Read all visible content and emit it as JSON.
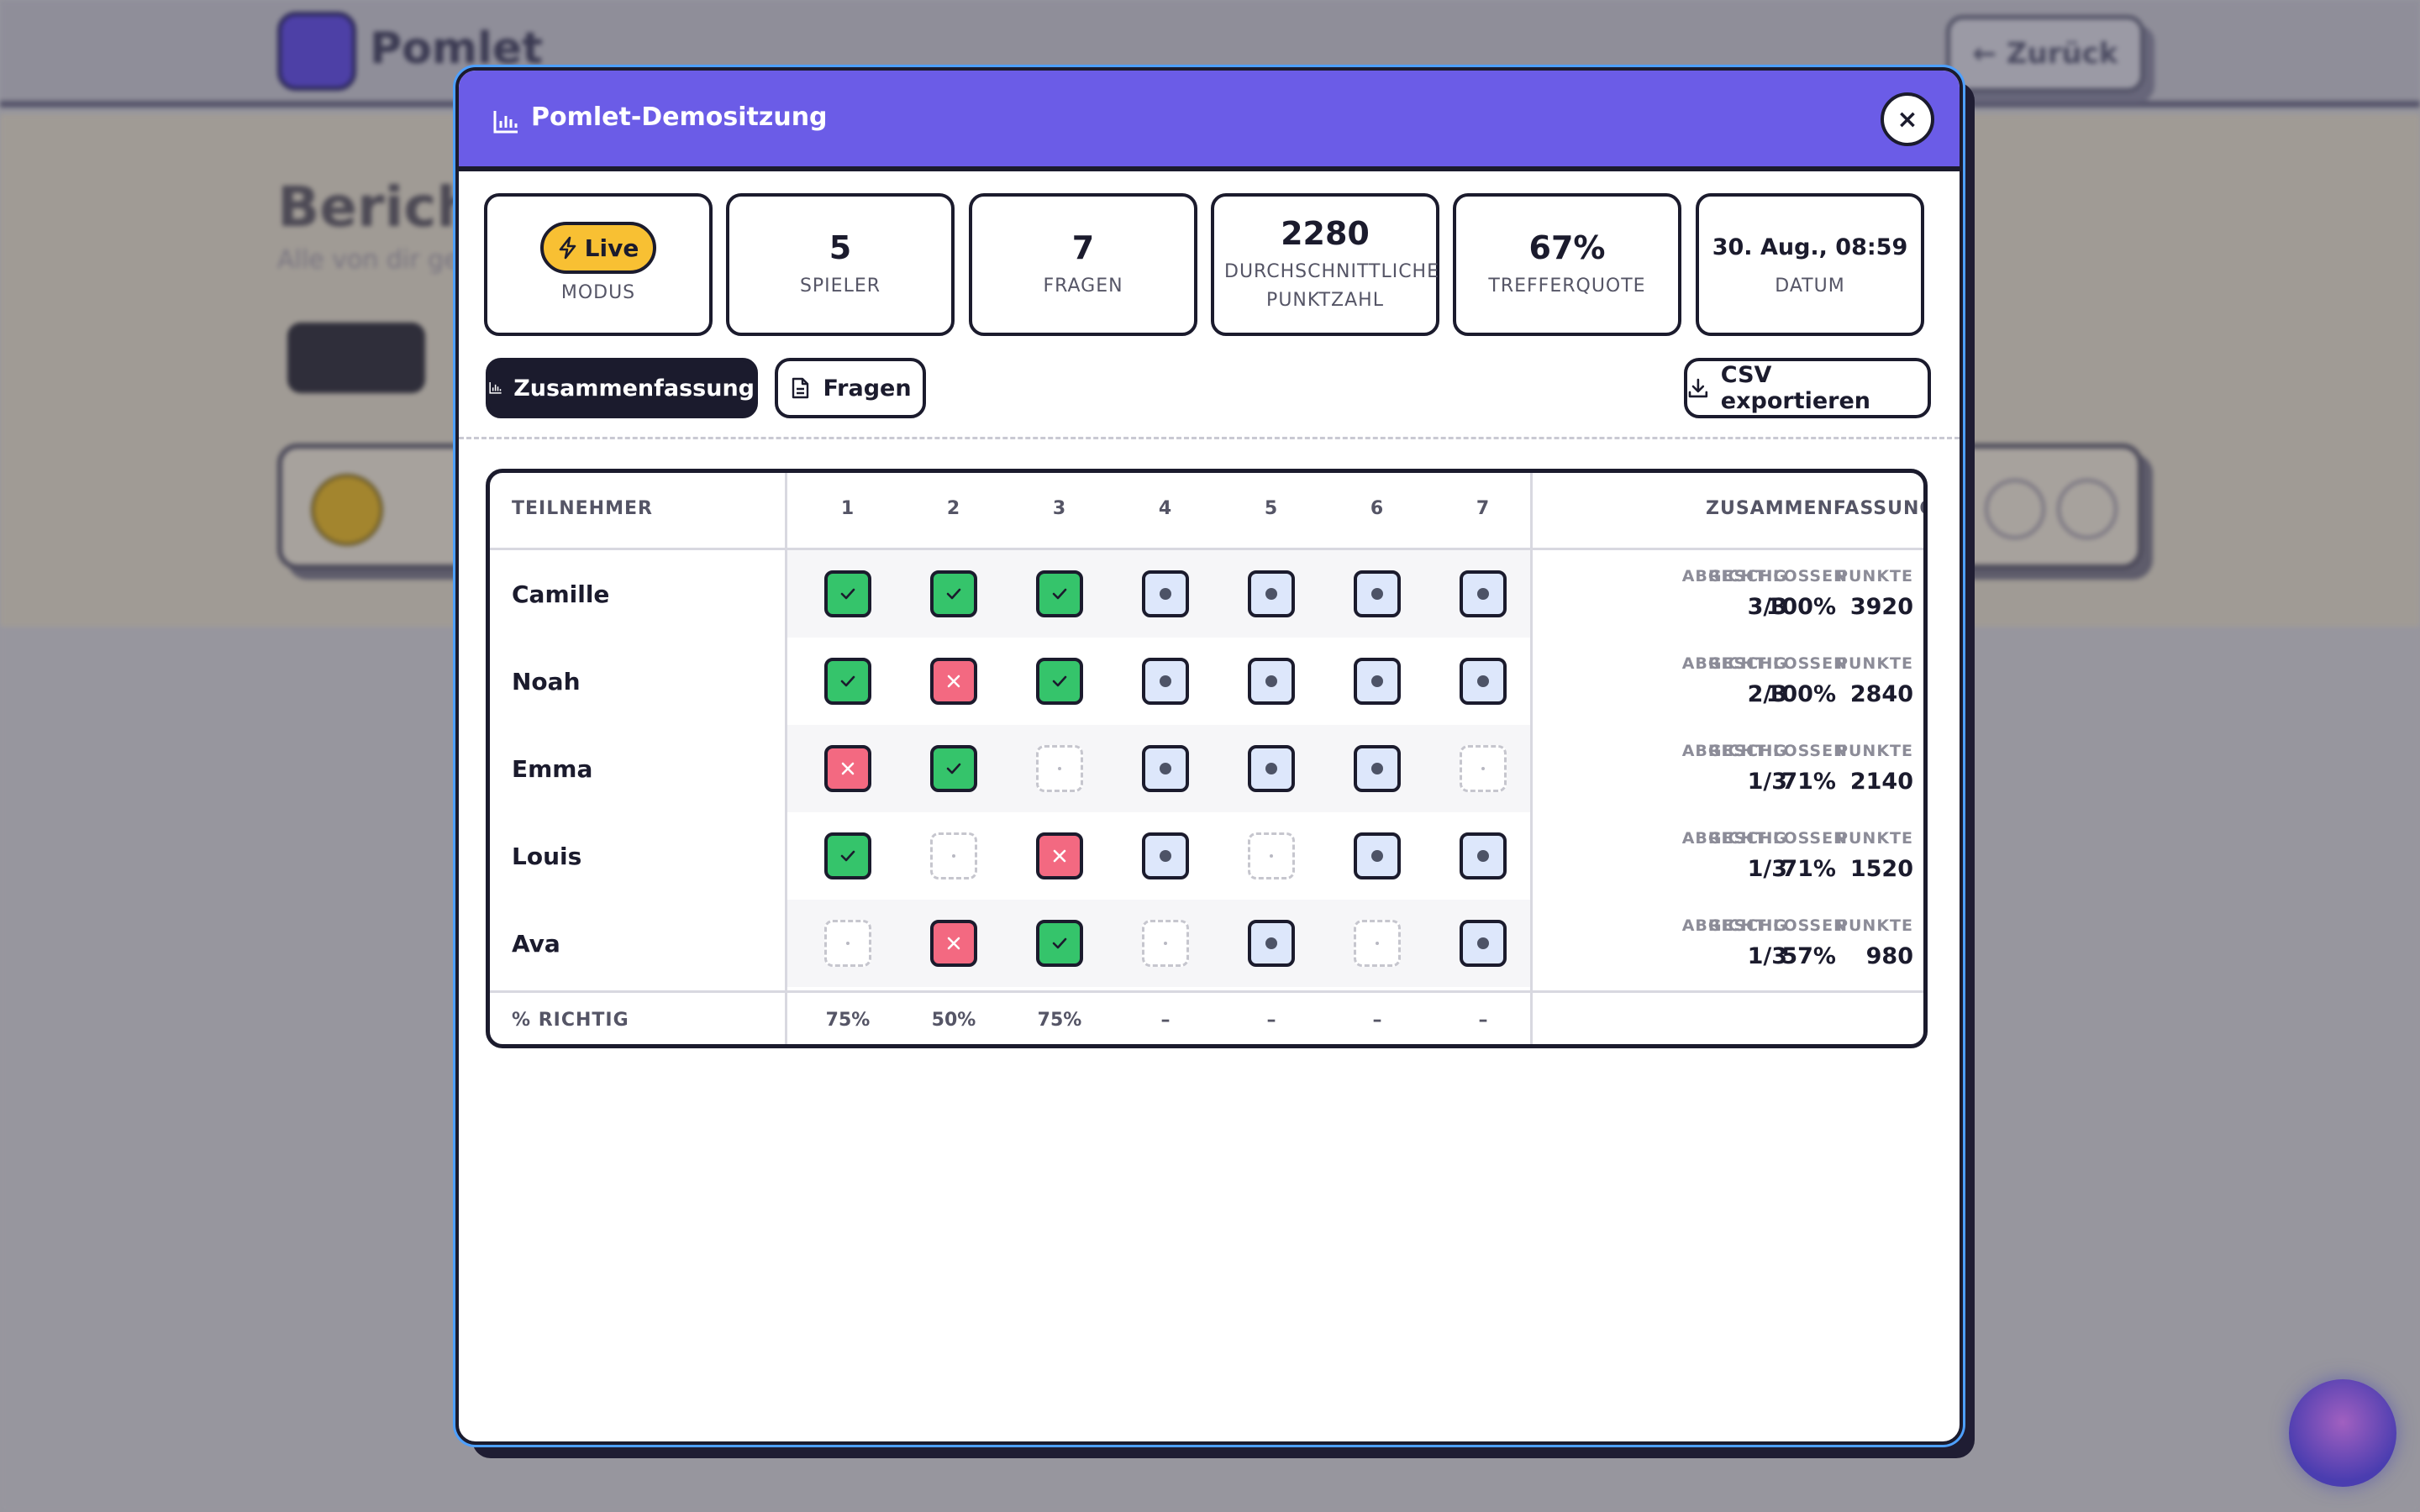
{
  "background": {
    "brand": "Pomlet",
    "back_label": "← Zurück",
    "page_title": "Bericht",
    "page_subtitle": "Alle von dir ge…"
  },
  "modal": {
    "title": "Pomlet-Demositzung",
    "close_label": "×",
    "stats": {
      "mode": {
        "badge": "Live",
        "label": "MODUS"
      },
      "players": {
        "value": "5",
        "label": "SPIELER"
      },
      "questions": {
        "value": "7",
        "label": "FRAGEN"
      },
      "avg_score": {
        "value": "2280",
        "label": "DURCHSCHNITTLICHE PUNKTZAHL"
      },
      "hit_rate": {
        "value": "67%",
        "label": "TREFFERQUOTE"
      },
      "date": {
        "value": "30. Aug., 08:59",
        "label": "DATUM"
      }
    },
    "tabs": {
      "summary": "Zusammenfassung",
      "questions": "Fragen"
    },
    "export_label": "CSV exportieren",
    "table": {
      "participant_header": "TEILNEHMER",
      "question_numbers": [
        "1",
        "2",
        "3",
        "4",
        "5",
        "6",
        "7"
      ],
      "summary_header": "ZUSAMMENFASSUNG",
      "col_correct": "RICHTIG",
      "col_completed": "ABGESCHLOSSEN",
      "col_points": "PUNKTE",
      "rows": [
        {
          "name": "Camille",
          "answers": [
            "ok",
            "ok",
            "ok",
            "pending",
            "pending",
            "pending",
            "pending"
          ],
          "correct": "3/3",
          "completed": "100%",
          "points": "3920"
        },
        {
          "name": "Noah",
          "answers": [
            "ok",
            "bad",
            "ok",
            "pending",
            "pending",
            "pending",
            "pending"
          ],
          "correct": "2/3",
          "completed": "100%",
          "points": "2840"
        },
        {
          "name": "Emma",
          "answers": [
            "bad",
            "ok",
            "none",
            "pending",
            "pending",
            "pending",
            "none"
          ],
          "correct": "1/3",
          "completed": "71%",
          "points": "2140"
        },
        {
          "name": "Louis",
          "answers": [
            "ok",
            "none",
            "bad",
            "pending",
            "none",
            "pending",
            "pending"
          ],
          "correct": "1/3",
          "completed": "71%",
          "points": "1520"
        },
        {
          "name": "Ava",
          "answers": [
            "none",
            "bad",
            "ok",
            "none",
            "pending",
            "none",
            "pending"
          ],
          "correct": "1/3",
          "completed": "57%",
          "points": "980"
        }
      ],
      "footer_label": "% RICHTIG",
      "footer_values": [
        "75%",
        "50%",
        "75%",
        "–",
        "–",
        "–",
        "–"
      ]
    }
  },
  "colors": {
    "header": "#6b5ce7",
    "correct": "#35c46b",
    "wrong": "#f36981",
    "pending": "#dde7fb",
    "live": "#f8c033",
    "ink": "#1b1b2d"
  }
}
